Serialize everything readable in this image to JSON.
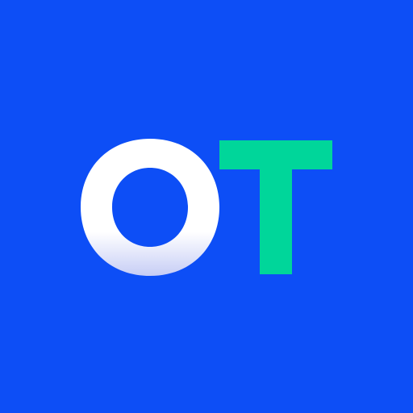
{
  "app_icon": {
    "logo_text": "OT",
    "background_color": "#0d4ef6",
    "letter_o_color": "#ffffff",
    "letter_o_gradient_end": "#c6cdf5",
    "letter_t_color": "#00d69a",
    "icon_name": "ot-logo-icon"
  }
}
